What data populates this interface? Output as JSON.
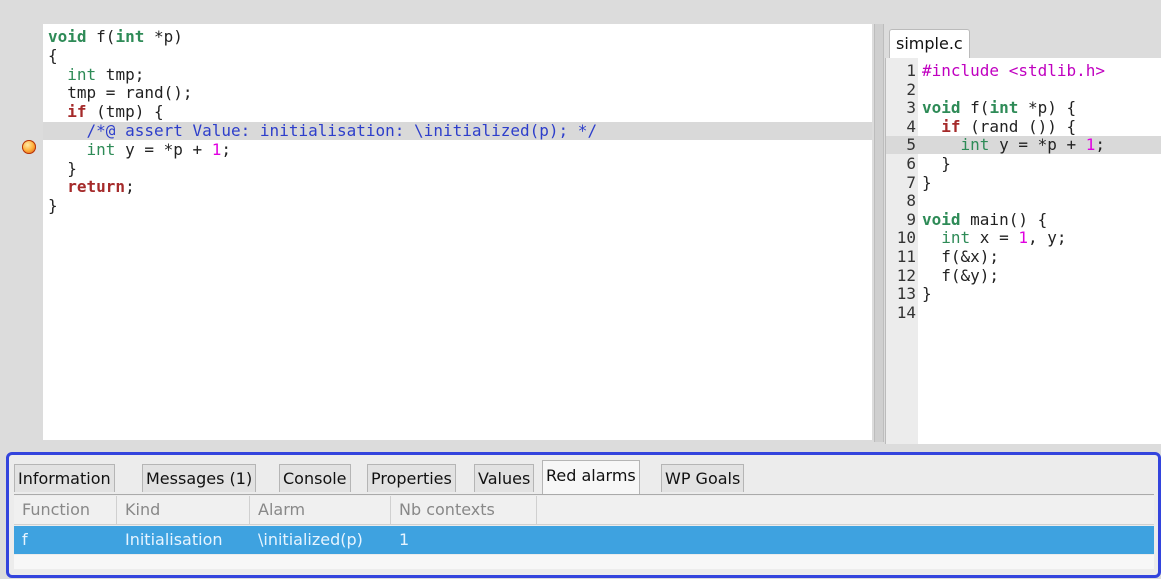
{
  "left_code": {
    "lines": [
      {
        "parts": [
          {
            "t": "void",
            "c": "kw"
          },
          {
            "t": " f("
          },
          {
            "t": "int",
            "c": "kw"
          },
          {
            "t": " *p)"
          }
        ]
      },
      {
        "parts": [
          {
            "t": "{"
          }
        ]
      },
      {
        "parts": [
          {
            "t": "  "
          },
          {
            "t": "int",
            "c": "type"
          },
          {
            "t": " tmp;"
          }
        ]
      },
      {
        "parts": [
          {
            "t": "  tmp = rand();"
          }
        ]
      },
      {
        "parts": [
          {
            "t": "  "
          },
          {
            "t": "if",
            "c": "ctl"
          },
          {
            "t": " (tmp) {"
          }
        ]
      },
      {
        "hl": true,
        "parts": [
          {
            "t": "    /*@ assert Value: initialisation: \\initialized(p); */",
            "c": "annot"
          }
        ]
      },
      {
        "parts": [
          {
            "t": "    "
          },
          {
            "t": "int",
            "c": "type"
          },
          {
            "t": " y = *p + "
          },
          {
            "t": "1",
            "c": "num"
          },
          {
            "t": ";"
          }
        ]
      },
      {
        "parts": [
          {
            "t": "  }"
          }
        ]
      },
      {
        "parts": [
          {
            "t": "  "
          },
          {
            "t": "return",
            "c": "ctl"
          },
          {
            "t": ";"
          }
        ]
      },
      {
        "parts": [
          {
            "t": "}"
          }
        ]
      }
    ]
  },
  "alarm_marker_icon": "orange-circle-icon",
  "source_tab": {
    "label": "simple.c"
  },
  "source_code": {
    "lines": [
      {
        "n": "1",
        "parts": [
          {
            "t": "#include <stdlib.h>",
            "c": "pp"
          }
        ]
      },
      {
        "n": "2",
        "parts": []
      },
      {
        "n": "3",
        "parts": [
          {
            "t": "void",
            "c": "kw"
          },
          {
            "t": " f("
          },
          {
            "t": "int",
            "c": "kw"
          },
          {
            "t": " *p) {"
          }
        ]
      },
      {
        "n": "4",
        "parts": [
          {
            "t": "  "
          },
          {
            "t": "if",
            "c": "ctl"
          },
          {
            "t": " (rand ()) {"
          }
        ]
      },
      {
        "n": "5",
        "hl": true,
        "parts": [
          {
            "t": "    "
          },
          {
            "t": "int",
            "c": "type"
          },
          {
            "t": " y = *p + "
          },
          {
            "t": "1",
            "c": "num"
          },
          {
            "t": ";"
          }
        ]
      },
      {
        "n": "6",
        "parts": [
          {
            "t": "  }"
          }
        ]
      },
      {
        "n": "7",
        "parts": [
          {
            "t": "}"
          }
        ]
      },
      {
        "n": "8",
        "parts": []
      },
      {
        "n": "9",
        "parts": [
          {
            "t": "void",
            "c": "kw"
          },
          {
            "t": " main() {"
          }
        ]
      },
      {
        "n": "10",
        "parts": [
          {
            "t": "  "
          },
          {
            "t": "int",
            "c": "type"
          },
          {
            "t": " x = "
          },
          {
            "t": "1",
            "c": "num"
          },
          {
            "t": ", y;"
          }
        ]
      },
      {
        "n": "11",
        "parts": [
          {
            "t": "  f(&x);"
          }
        ]
      },
      {
        "n": "12",
        "parts": [
          {
            "t": "  f(&y);"
          }
        ]
      },
      {
        "n": "13",
        "parts": [
          {
            "t": "}"
          }
        ]
      },
      {
        "n": "14",
        "parts": []
      }
    ]
  },
  "bottom_tabs": {
    "items": [
      {
        "label": "Information"
      },
      {
        "label": "Messages (1)"
      },
      {
        "label": "Console"
      },
      {
        "label": "Properties"
      },
      {
        "label": "Values"
      },
      {
        "label": "Red alarms",
        "active": true
      },
      {
        "label": "WP Goals"
      }
    ]
  },
  "alarms_table": {
    "headers": [
      "Function",
      "Kind",
      "Alarm",
      "Nb contexts"
    ],
    "rows": [
      [
        "f",
        "Initialisation",
        "\\initialized(p)",
        "1"
      ]
    ]
  },
  "colors": {
    "keyword": "#2e8b57",
    "control": "#a52a2a",
    "number": "#e000e0",
    "annotation": "#2d3ecb",
    "preprocessor": "#c000c0",
    "selection": "#3ea2e0",
    "panel_border": "#3344dd"
  }
}
